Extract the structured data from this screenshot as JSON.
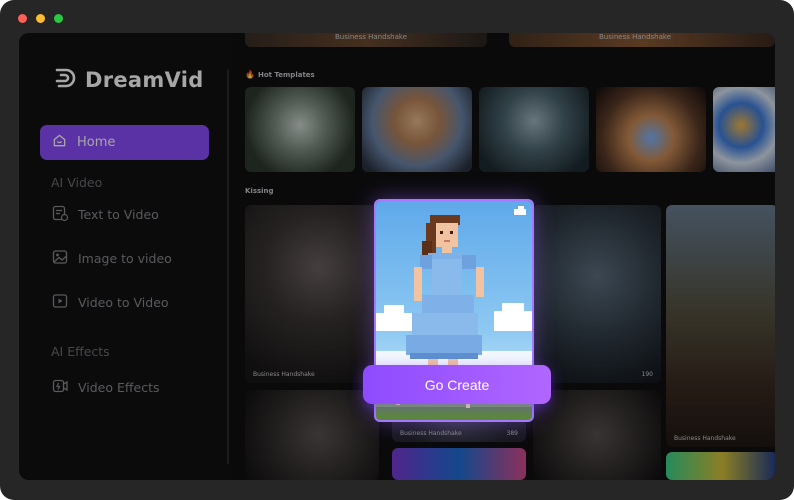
{
  "window": {
    "dot_colors": [
      "#ff5f57",
      "#febc2e",
      "#28c840"
    ]
  },
  "brand": {
    "name": "DreamVid"
  },
  "sidebar": {
    "home_label": "Home",
    "section_ai_video": "AI Video",
    "items": [
      {
        "label": "Text to Video",
        "icon": "text-to-video-icon"
      },
      {
        "label": "Image to video",
        "icon": "image-icon"
      },
      {
        "label": "Video to Video",
        "icon": "video-icon"
      }
    ],
    "section_ai_effects": "AI Effects",
    "effects_items": [
      {
        "label": "Video Effects",
        "icon": "video-effects-icon"
      }
    ]
  },
  "main": {
    "top_captions": [
      "Business Handshake",
      "Business Handshake"
    ],
    "hot_title": "Hot Templates",
    "kissing_title": "Kissing",
    "card_caption": "Business Handshake",
    "likes": [
      "190",
      "389"
    ]
  },
  "cta": {
    "label": "Go Create"
  }
}
